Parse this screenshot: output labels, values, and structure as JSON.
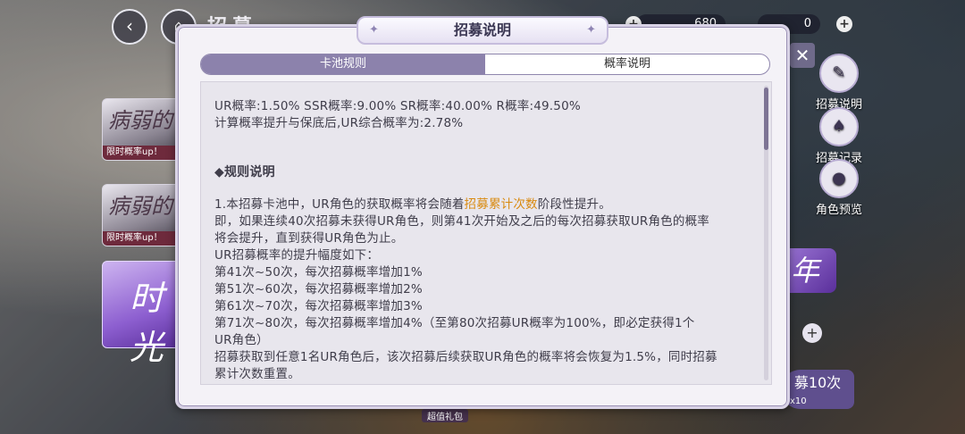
{
  "background": {
    "page_title": "招募",
    "resource_1_value": "680",
    "resource_2_value": "0",
    "banner_1_title": "病弱的",
    "banner_1_tag": "限时概率up！",
    "banner_2_title": "病弱的",
    "banner_2_tag": "限时概率up！",
    "banner_3_title": "时光",
    "side_menu": [
      {
        "label": "招募说明"
      },
      {
        "label": "招募记录"
      },
      {
        "label": "角色预览"
      }
    ],
    "recruit_10_label": "募10次",
    "recruit_10_cost": "x10",
    "bottom_tag": "超值礼包"
  },
  "modal": {
    "title": "招募说明",
    "tabs": [
      {
        "label": "卡池规则",
        "active": true
      },
      {
        "label": "概率说明",
        "active": false
      }
    ],
    "rates_line": "UR概率:1.50% SSR概率:9.00% SR概率:40.00% R概率:49.50%",
    "rates_note": "计算概率提升与保底后,UR综合概率为:2.78%",
    "section_title": "◆规则说明",
    "rule_1_prefix": "1.本招募卡池中，UR角色的获取概率将会随着",
    "rule_1_highlight": "招募累计次数",
    "rule_1_suffix": "阶段性提升。",
    "rule_2_a": "即，如果连续40次招募未获得UR角色，则第41次开始及之后的每次招募获取UR角色的概率",
    "rule_2_b": "将会提升，直到获得UR角色为止。",
    "rule_3": "UR招募概率的提升幅度如下：",
    "step_1": "第41次~50次，每次招募概率增加1%",
    "step_2": "第51次~60次，每次招募概率增加2%",
    "step_3": "第61次~70次，每次招募概率增加3%",
    "step_4_a": "第71次~80次，每次招募概率增加4%（至第80次招募UR概率为100%，即必定获得1个",
    "step_4_b": "UR角色）",
    "reset_a": "招募获取到任意1名UR角色后，该次招募后续获取UR角色的概率将会恢复为1.5%，同时招募",
    "reset_b": "累计次数重置。"
  },
  "colors": {
    "highlight": "#d98a10",
    "tab_active": "#8c82ac"
  }
}
